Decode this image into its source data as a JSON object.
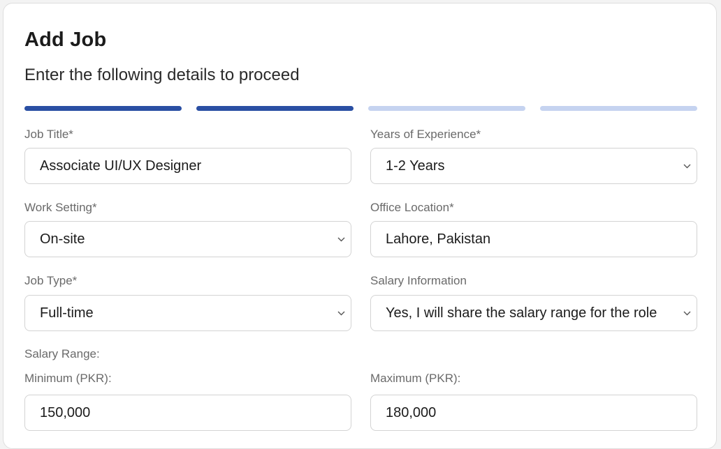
{
  "form": {
    "title": "Add Job",
    "subtitle": "Enter the following details to proceed",
    "progress": {
      "total_steps": 4,
      "completed_steps": 2,
      "active_color": "#2a4fa3",
      "inactive_color": "#c5d3f0"
    },
    "fields": {
      "job_title": {
        "label": "Job Title*",
        "value": "Associate UI/UX Designer"
      },
      "experience": {
        "label": "Years of Experience*",
        "value": "1-2 Years",
        "icon": "chevron-down-icon"
      },
      "work_setting": {
        "label": "Work Setting*",
        "value": "On-site",
        "icon": "chevron-down-icon"
      },
      "office_location": {
        "label": "Office Location*",
        "value": "Lahore, Pakistan"
      },
      "job_type": {
        "label": "Job Type*",
        "value": "Full-time",
        "icon": "chevron-down-icon"
      },
      "salary_info": {
        "label": "Salary Information",
        "value": "Yes, I will share the salary range for the role",
        "icon": "chevron-down-icon"
      }
    },
    "salary_range": {
      "heading": "Salary Range:",
      "minimum": {
        "label": "Minimum (PKR):",
        "value": "150,000"
      },
      "maximum": {
        "label": "Maximum (PKR):",
        "value": "180,000"
      }
    }
  }
}
